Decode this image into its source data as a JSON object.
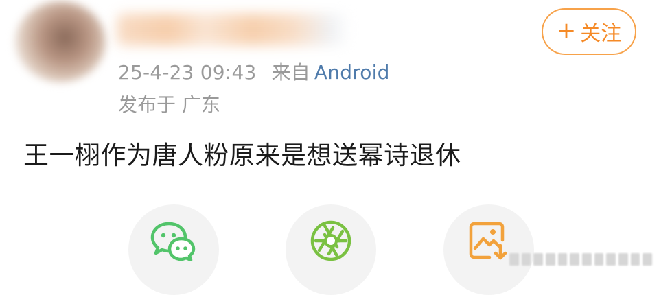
{
  "post": {
    "meta": {
      "timestamp": "25-4-23 09:43",
      "source_prefix": "来自",
      "device": "Android"
    },
    "location": "发布于 广东",
    "text": "王一栩作为唐人粉原来是想送幂诗退休"
  },
  "header": {
    "follow_plus": "+",
    "follow_label": "关注"
  },
  "share": {
    "icons": [
      "wechat-icon",
      "moments-icon",
      "save-image-icon"
    ],
    "colors": {
      "wechat": "#52c46a",
      "moments": "#7ac142",
      "save": "#f2a23c"
    }
  },
  "theme": {
    "accent": "#f58a27",
    "link": "#4f7bab",
    "muted": "#9a9a9a"
  }
}
